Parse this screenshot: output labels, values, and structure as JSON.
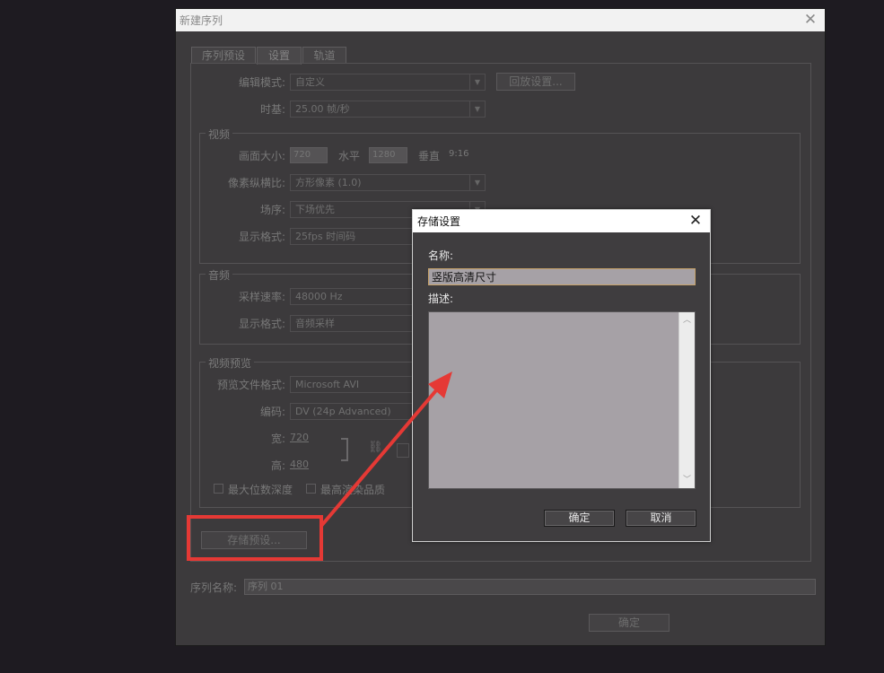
{
  "main_dialog": {
    "title": "新建序列",
    "tabs": [
      "序列预设",
      "设置",
      "轨道"
    ],
    "edit_mode": {
      "label": "编辑模式:",
      "value": "自定义",
      "playback_button": "回放设置..."
    },
    "timebase": {
      "label": "时基:",
      "value": "25.00 帧/秒"
    },
    "video": {
      "group_title": "视频",
      "frame_size": {
        "label": "画面大小:",
        "width": "720",
        "h_label": "水平",
        "height": "1280",
        "v_label": "垂直",
        "ratio": "9:16"
      },
      "pixel_aspect": {
        "label": "像素纵横比:",
        "value": "方形像素 (1.0)"
      },
      "fields": {
        "label": "场序:",
        "value": "下场优先"
      },
      "display_format": {
        "label": "显示格式:",
        "value": "25fps 时间码"
      }
    },
    "audio": {
      "group_title": "音频",
      "sample_rate": {
        "label": "采样速率:",
        "value": "48000 Hz"
      },
      "display_format": {
        "label": "显示格式:",
        "value": "音频采样"
      }
    },
    "video_preview": {
      "group_title": "视频预览",
      "file_format": {
        "label": "预览文件格式:",
        "value": "Microsoft AVI"
      },
      "codec": {
        "label": "编码:",
        "value": "DV (24p Advanced)"
      },
      "width": {
        "label": "宽:",
        "value": "720"
      },
      "height": {
        "label": "高:",
        "value": "480"
      },
      "max_bit_depth": "最大位数深度",
      "max_render_quality": "最高渲染品质"
    },
    "save_preset_button": "存储预设...",
    "sequence_name": {
      "label": "序列名称:",
      "value": "序列 01"
    },
    "ok_button": "确定"
  },
  "save_dialog": {
    "title": "存储设置",
    "name_label": "名称:",
    "name_value": "竖版高清尺寸",
    "description_label": "描述:",
    "description_value": "",
    "ok_button": "确定",
    "cancel_button": "取消"
  },
  "icons": {
    "close": "close-icon",
    "dropdown": "chevron-down-icon",
    "link": "link-icon",
    "scroll_up": "scroll-up-icon",
    "scroll_down": "scroll-down-icon"
  },
  "annotation": {
    "color": "#e53935"
  }
}
